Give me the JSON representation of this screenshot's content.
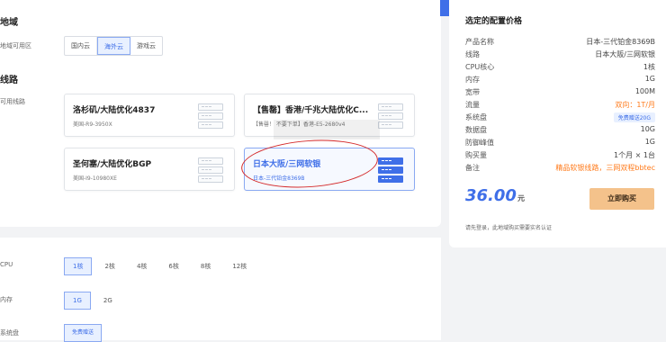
{
  "region": {
    "section_title": "地域",
    "row_label": "地域可用区",
    "options": [
      "国内云",
      "海外云",
      "游戏云"
    ]
  },
  "line": {
    "section_title": "线路",
    "row_label": "可用线路",
    "cards": [
      {
        "title": "洛杉矶/大陆优化4837",
        "sub": "美国-R9-3950X"
      },
      {
        "title": "【售罄】香港/千兆大陆优化C...",
        "sub": "【售罄！ 不要下单】香港-E5-2680v4"
      },
      {
        "title": "圣何塞/大陆优化BGP",
        "sub": "美国-I9-10980XE"
      },
      {
        "title": "日本大阪/三网软银",
        "sub": "日本-三代铂金8369B"
      }
    ]
  },
  "cpu": {
    "row_label": "CPU",
    "options": [
      "1核",
      "2核",
      "4核",
      "6核",
      "8核",
      "12核"
    ]
  },
  "memory": {
    "row_label": "内存",
    "options": [
      "1G",
      "2G"
    ]
  },
  "system_disk": {
    "row_label": "系统盘",
    "option": "免费赠送"
  },
  "summary": {
    "title": "选定的配置价格",
    "rows": [
      {
        "k": "产品名称",
        "v": "日本-三代铂金8369B"
      },
      {
        "k": "线路",
        "v": "日本大阪/三网软银"
      },
      {
        "k": "CPU核心",
        "v": "1核"
      },
      {
        "k": "内存",
        "v": "1G"
      },
      {
        "k": "宽带",
        "v": "100M"
      },
      {
        "k": "流量",
        "v": "双向：1T/月"
      },
      {
        "k": "系统盘",
        "v": "免费赠送20G"
      },
      {
        "k": "数据盘",
        "v": "10G"
      },
      {
        "k": "防御峰值",
        "v": "1G"
      },
      {
        "k": "购买量",
        "v": "1个月 × 1台"
      },
      {
        "k": "备注",
        "v": "精品软银线路，三网双程bbtec"
      }
    ],
    "price": "36.00",
    "price_unit": "元",
    "buy_label": "立即购买",
    "note": "请先登录，此地域购买需要实名认证"
  },
  "colors": {
    "accent": "#3f6fe8",
    "orange": "#ff7a1a",
    "buy_button": "#f4c28b",
    "annotation": "#d42a2a"
  }
}
